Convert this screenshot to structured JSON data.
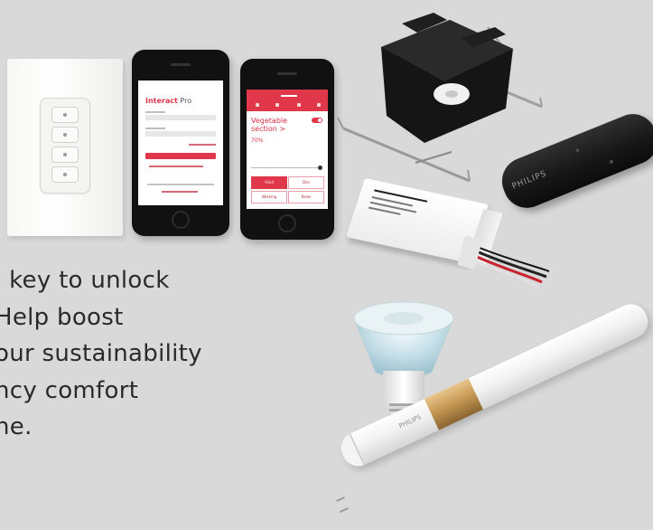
{
  "copy": {
    "lines": [
      "l key to unlock",
      " Help boost",
      "our sustainability",
      "ncy comfort",
      "ne."
    ]
  },
  "phone_app_login": {
    "brand": "Interact",
    "brand_suffix": "Pro"
  },
  "phone_app_scene": {
    "scene_title_line1": "Vegetable",
    "scene_title_line2": "section >",
    "level": "70%",
    "tiles": [
      "Vivid",
      "Dim",
      "Working",
      "Relax"
    ]
  },
  "remote": {
    "brand": "PHILIPS"
  },
  "tube_lamp": {
    "brand": "PHILIPS"
  },
  "colors": {
    "background": "#d9d9d9",
    "accent_red": "#e0384a",
    "text": "#2a2a2a",
    "gold_band": "#c89a55"
  },
  "icons": [
    "wall-switch-icon",
    "smartphone-icon",
    "junction-box-icon",
    "remote-control-icon",
    "led-driver-icon",
    "led-bulb-icon",
    "led-tube-icon"
  ]
}
